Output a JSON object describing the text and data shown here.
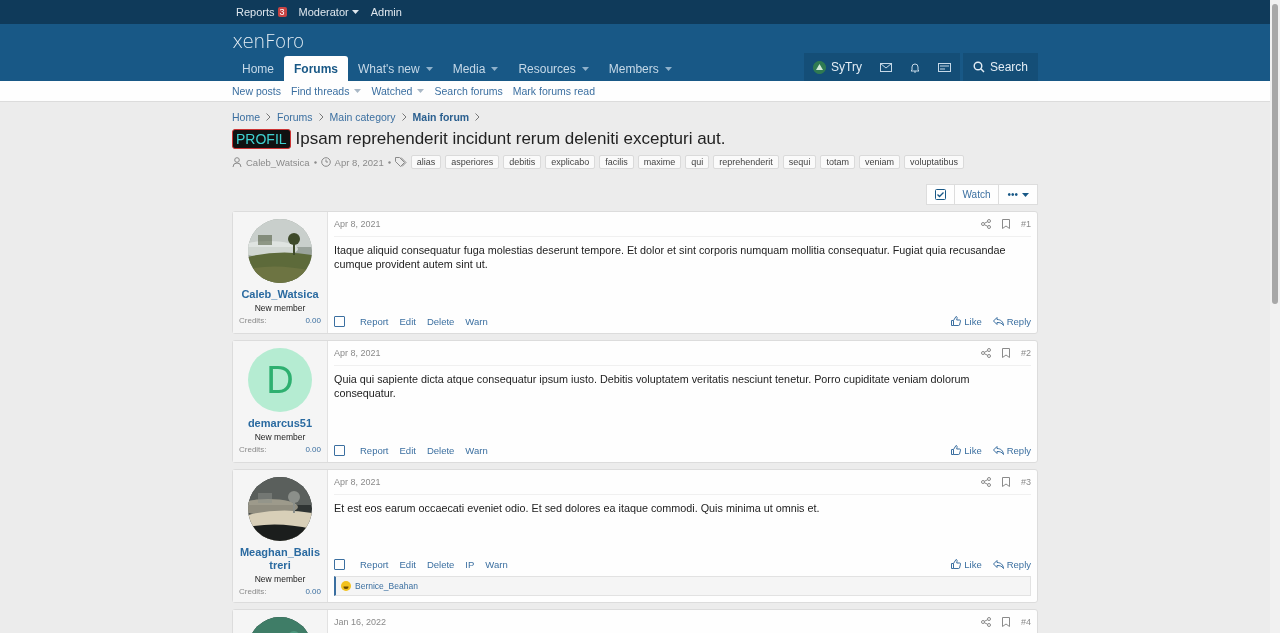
{
  "staff_bar": [
    {
      "label": "Reports",
      "badge": "3",
      "menu": false
    },
    {
      "label": "Moderator",
      "menu": true
    },
    {
      "label": "Admin",
      "menu": false
    }
  ],
  "logo": "xenForo",
  "nav": [
    {
      "label": "Home",
      "selected": false,
      "menu": false
    },
    {
      "label": "Forums",
      "selected": true,
      "menu": false
    },
    {
      "label": "What's new",
      "selected": false,
      "menu": true
    },
    {
      "label": "Media",
      "selected": false,
      "menu": true
    },
    {
      "label": "Resources",
      "selected": false,
      "menu": true
    },
    {
      "label": "Members",
      "selected": false,
      "menu": true
    }
  ],
  "account": {
    "username": "SyTry",
    "search": "Search"
  },
  "sub_nav": [
    {
      "label": "New posts",
      "menu": false
    },
    {
      "label": "Find threads",
      "menu": true
    },
    {
      "label": "Watched",
      "menu": true
    },
    {
      "label": "Search forums",
      "menu": false
    },
    {
      "label": "Mark forums read",
      "menu": false
    }
  ],
  "breadcrumbs": [
    {
      "label": "Home",
      "current": false
    },
    {
      "label": "Forums",
      "current": false
    },
    {
      "label": "Main category",
      "current": false
    },
    {
      "label": "Main forum",
      "current": true
    }
  ],
  "thread": {
    "prefix": "PROFIL",
    "title": "Ipsam reprehenderit incidunt rerum deleniti excepturi aut.",
    "author": "Caleb_Watsica",
    "date": "Apr 8, 2021",
    "tags": [
      "alias",
      "asperiores",
      "debitis",
      "explicabo",
      "facilis",
      "maxime",
      "qui",
      "reprehenderit",
      "sequi",
      "totam",
      "veniam",
      "voluptatibus"
    ],
    "watch": "Watch",
    "more": "•••"
  },
  "posts": [
    {
      "avatar": {
        "kind": "picture"
      },
      "username": "Caleb_Watsica",
      "role": "New member",
      "credits_label": "Credits:",
      "credits": "0.00",
      "date": "Apr 8, 2021",
      "number": "#1",
      "text": "Itaque aliquid consequatur fuga molestias deserunt tempore. Et dolor et sint corporis numquam mollitia consequatur. Fugiat quia recusandae cumque provident autem sint ut.",
      "selected": false,
      "actions": [
        "Report",
        "Edit",
        "Delete",
        "Warn"
      ],
      "like": "Like",
      "reply": "Reply"
    },
    {
      "avatar": {
        "kind": "letter",
        "letter": "D"
      },
      "username": "demarcus51",
      "role": "New member",
      "credits_label": "Credits:",
      "credits": "0.00",
      "date": "Apr 8, 2021",
      "number": "#2",
      "text": "Quia qui sapiente dicta atque consequatur ipsum iusto. Debitis voluptatem veritatis nesciunt tenetur. Porro cupiditate veniam dolorum consequatur.",
      "selected": false,
      "actions": [
        "Report",
        "Edit",
        "Delete",
        "Warn"
      ],
      "like": "Like",
      "reply": "Reply"
    },
    {
      "avatar": {
        "kind": "picture"
      },
      "username": "Meaghan_Balistreri",
      "role": "New member",
      "credits_label": "Credits:",
      "credits": "0.00",
      "date": "Apr 8, 2021",
      "number": "#3",
      "text": "Et est eos earum occaecati eveniet odio. Et sed dolores ea itaque commodi. Quis minima ut omnis et.",
      "selected": false,
      "actions": [
        "Report",
        "Edit",
        "Delete",
        "IP",
        "Warn"
      ],
      "like": "Like",
      "reply": "Reply",
      "reactions": "Bernice_Beahan"
    },
    {
      "avatar": {
        "kind": "picture"
      },
      "date": "Jan 16, 2022",
      "number": "#4"
    }
  ]
}
